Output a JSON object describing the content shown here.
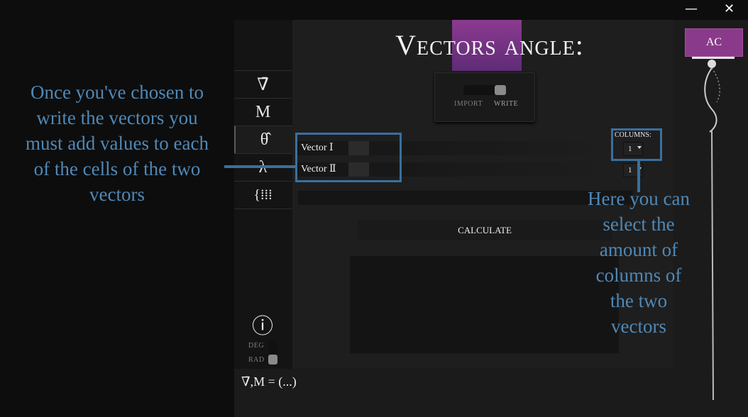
{
  "window": {
    "minimize_glyph": "—",
    "close_glyph": "✕"
  },
  "sidebar": {
    "items": [
      {
        "label": "∇̄",
        "icon": "vector-nabla-icon"
      },
      {
        "label": "M",
        "icon": "matrix-icon"
      },
      {
        "label": "θ̂",
        "icon": "theta-icon"
      },
      {
        "label": "λ",
        "icon": "lambda-icon"
      },
      {
        "label": "{⁞⁞⁞",
        "icon": "system-icon"
      }
    ],
    "info_glyph": "ⓘ",
    "deg_label": "DEG",
    "rad_label": "RAD"
  },
  "header": {
    "title": "Vectors angle:"
  },
  "mode": {
    "import_label": "IMPORT",
    "write_label": "WRITE",
    "selected": "WRITE"
  },
  "vectors": [
    {
      "label": "Vector Ⅰ",
      "columns_value": "1"
    },
    {
      "label": "Vector Ⅱ",
      "columns_value": "1"
    }
  ],
  "columns_label": "COLUMNS:",
  "calculate_label": "CALCULATE",
  "formula": "∇̄,M = (...)",
  "ac_label": "AC",
  "annotations": {
    "left": [
      "Once you've chosen to",
      "write the vectors you",
      "must add values to each",
      "of the cells of the two",
      "vectors"
    ],
    "right": [
      "Here you can",
      "select the",
      "amount of",
      "columns of",
      "the two",
      "vectors"
    ]
  },
  "colors": {
    "accent": "#8a3a8a",
    "annotation": "#4f88b7",
    "highlight": "#3b6f9e"
  }
}
